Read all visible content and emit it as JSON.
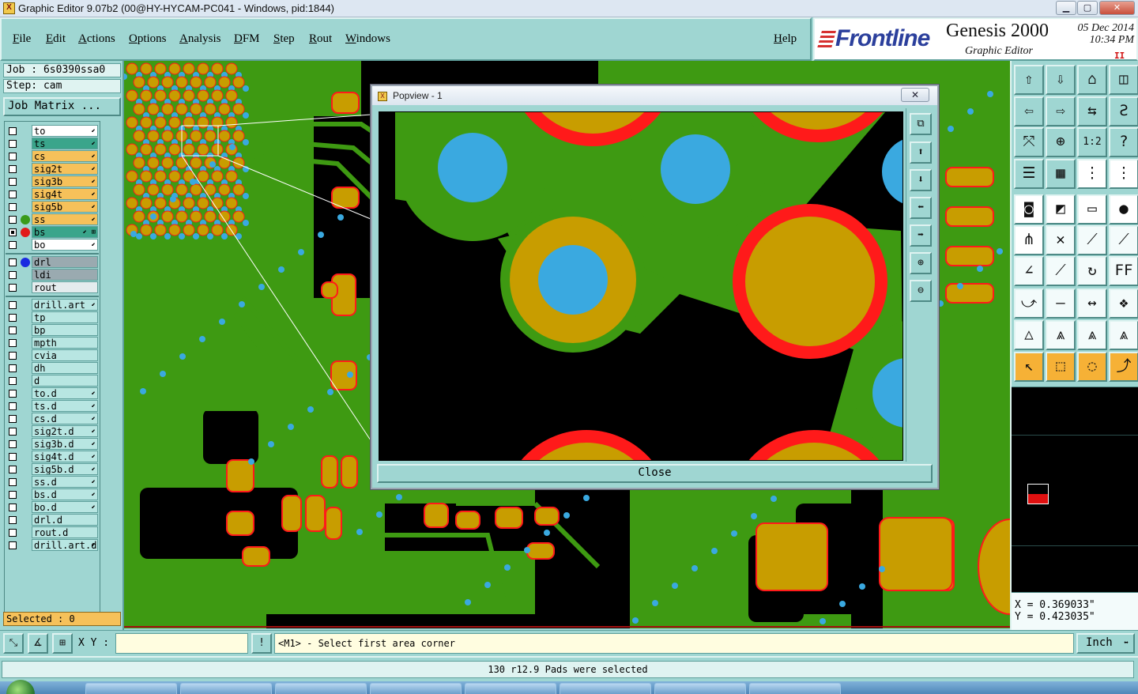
{
  "window": {
    "title": "Graphic Editor 9.07b2 (00@HY-HYCAM-PC041 - Windows, pid:1844)",
    "app_icon": "X"
  },
  "menu": {
    "items": [
      {
        "label": "File",
        "underline": "F",
        "rest": "ile"
      },
      {
        "label": "Edit",
        "underline": "E",
        "rest": "dit"
      },
      {
        "label": "Actions",
        "underline": "A",
        "rest": "ctions"
      },
      {
        "label": "Options",
        "underline": "O",
        "rest": "ptions"
      },
      {
        "label": "Analysis",
        "underline": "A",
        "rest": "nalysis"
      },
      {
        "label": "DFM",
        "underline": "D",
        "rest": "FM"
      },
      {
        "label": "Step",
        "underline": "S",
        "rest": "tep"
      },
      {
        "label": "Rout",
        "underline": "R",
        "rest": "out"
      },
      {
        "label": "Windows",
        "underline": "W",
        "rest": "indows"
      }
    ],
    "help": {
      "underline": "H",
      "rest": "elp"
    }
  },
  "brand": {
    "logo": "Frontline",
    "product": "Genesis 2000",
    "subtitle": "Graphic Editor",
    "date": "05 Dec 2014",
    "time": "10:34 PM",
    "pause_glyph": "II"
  },
  "job": {
    "job_line": "Job : 6s0390ssa0",
    "step_line": "Step: cam",
    "matrix_button": "Job Matrix ..."
  },
  "layers": [
    {
      "name": "to",
      "fill": "#ffffff",
      "dot": "",
      "mark": "⬋",
      "sel": false
    },
    {
      "name": "ts",
      "fill": "#3aa58b",
      "dot": "",
      "mark": "⬋",
      "sel": false
    },
    {
      "name": "cs",
      "fill": "#f6c15a",
      "dot": "",
      "mark": "⬋",
      "sel": false
    },
    {
      "name": "sig2t",
      "fill": "#f6c15a",
      "dot": "",
      "mark": "⬋",
      "sel": false
    },
    {
      "name": "sig3b",
      "fill": "#f6c15a",
      "dot": "",
      "mark": "⬋",
      "sel": false
    },
    {
      "name": "sig4t",
      "fill": "#f6c15a",
      "dot": "",
      "mark": "⬋",
      "sel": false
    },
    {
      "name": "sig5b",
      "fill": "#f6c15a",
      "dot": "",
      "mark": "⬋",
      "sel": false
    },
    {
      "name": "ss",
      "fill": "#f6c15a",
      "dot": "#3a9a1a",
      "mark": "⬋",
      "sel": false
    },
    {
      "name": "bs",
      "fill": "#3aa58b",
      "dot": "#e01a1a",
      "mark": "⬋ ⊞",
      "sel": true
    },
    {
      "name": "bo",
      "fill": "#ffffff",
      "dot": "",
      "mark": "⬋",
      "sel": false
    },
    {
      "name": "drl",
      "fill": "#9aaab0",
      "dot": "#1a2ae0",
      "mark": "",
      "sel": false
    },
    {
      "name": "ldi",
      "fill": "#9aaab0",
      "dot": "",
      "mark": "",
      "sel": false
    },
    {
      "name": "rout",
      "fill": "#e4ecee",
      "dot": "",
      "mark": "",
      "sel": false
    },
    {
      "name": "drill.art",
      "fill": "#b8e6e2",
      "dot": "",
      "mark": "⬋",
      "sel": false
    },
    {
      "name": "tp",
      "fill": "#b8e6e2",
      "dot": "",
      "mark": "",
      "sel": false
    },
    {
      "name": "bp",
      "fill": "#b8e6e2",
      "dot": "",
      "mark": "",
      "sel": false
    },
    {
      "name": "mpth",
      "fill": "#b8e6e2",
      "dot": "",
      "mark": "",
      "sel": false
    },
    {
      "name": "cvia",
      "fill": "#b8e6e2",
      "dot": "",
      "mark": "",
      "sel": false
    },
    {
      "name": "dh",
      "fill": "#b8e6e2",
      "dot": "",
      "mark": "",
      "sel": false
    },
    {
      "name": "d",
      "fill": "#b8e6e2",
      "dot": "",
      "mark": "",
      "sel": false
    },
    {
      "name": "to.d",
      "fill": "#b8e6e2",
      "dot": "",
      "mark": "⬋",
      "sel": false
    },
    {
      "name": "ts.d",
      "fill": "#b8e6e2",
      "dot": "",
      "mark": "⬋",
      "sel": false
    },
    {
      "name": "cs.d",
      "fill": "#b8e6e2",
      "dot": "",
      "mark": "⬋",
      "sel": false
    },
    {
      "name": "sig2t.d",
      "fill": "#b8e6e2",
      "dot": "",
      "mark": "⬋",
      "sel": false
    },
    {
      "name": "sig3b.d",
      "fill": "#b8e6e2",
      "dot": "",
      "mark": "⬋",
      "sel": false
    },
    {
      "name": "sig4t.d",
      "fill": "#b8e6e2",
      "dot": "",
      "mark": "⬋",
      "sel": false
    },
    {
      "name": "sig5b.d",
      "fill": "#b8e6e2",
      "dot": "",
      "mark": "⬋",
      "sel": false
    },
    {
      "name": "ss.d",
      "fill": "#b8e6e2",
      "dot": "",
      "mark": "⬋",
      "sel": false
    },
    {
      "name": "bs.d",
      "fill": "#b8e6e2",
      "dot": "",
      "mark": "⬋",
      "sel": false
    },
    {
      "name": "bo.d",
      "fill": "#b8e6e2",
      "dot": "",
      "mark": "⬋",
      "sel": false
    },
    {
      "name": "drl.d",
      "fill": "#b8e6e2",
      "dot": "",
      "mark": "",
      "sel": false
    },
    {
      "name": "rout.d",
      "fill": "#b8e6e2",
      "dot": "",
      "mark": "",
      "sel": false
    },
    {
      "name": "drill.art.d",
      "fill": "#b8e6e2",
      "dot": "",
      "mark": "⬋",
      "sel": false
    }
  ],
  "selected": "Selected : 0",
  "popview": {
    "title": "Popview - 1",
    "close_x": "✕",
    "close_button": "Close",
    "tools": [
      {
        "icon": "zoom-fit-icon",
        "glyph": "⧉"
      },
      {
        "icon": "pan-up-icon",
        "glyph": "⬆"
      },
      {
        "icon": "pan-down-icon",
        "glyph": "⬇"
      },
      {
        "icon": "pan-left-icon",
        "glyph": "⬅"
      },
      {
        "icon": "pan-right-icon",
        "glyph": "➡"
      },
      {
        "icon": "zoom-in-icon",
        "glyph": "⊕"
      },
      {
        "icon": "zoom-out-icon",
        "glyph": "⊖"
      }
    ]
  },
  "toolbox": [
    {
      "icon": "pan-up-icon",
      "glyph": "⇧",
      "style": ""
    },
    {
      "icon": "pan-down-icon",
      "glyph": "⇩",
      "style": ""
    },
    {
      "icon": "home-icon",
      "glyph": "⌂",
      "style": ""
    },
    {
      "icon": "window-split-icon",
      "glyph": "◫",
      "style": ""
    },
    {
      "icon": "pan-left-icon",
      "glyph": "⇦",
      "style": ""
    },
    {
      "icon": "pan-right-icon",
      "glyph": "⇨",
      "style": ""
    },
    {
      "icon": "swap-icon",
      "glyph": "⇆",
      "style": ""
    },
    {
      "icon": "redraw-icon",
      "glyph": "Ƨ",
      "style": ""
    },
    {
      "icon": "zoom-fit-icon",
      "glyph": "⤧",
      "style": ""
    },
    {
      "icon": "zoom-center-icon",
      "glyph": "⊕",
      "style": ""
    },
    {
      "icon": "scale-1-2-icon",
      "glyph": "1:2",
      "style": ""
    },
    {
      "icon": "help-icon",
      "glyph": "?",
      "style": ""
    },
    {
      "icon": "settings-icon",
      "glyph": "☰",
      "style": ""
    },
    {
      "icon": "grid-icon",
      "glyph": "▦",
      "style": ""
    },
    {
      "icon": "layers-icon",
      "glyph": "⋮",
      "style": "white"
    },
    {
      "icon": "layers-red-icon",
      "glyph": "⋮",
      "style": "white"
    },
    {
      "icon": "pad-select-icon",
      "glyph": "◙",
      "style": "white"
    },
    {
      "icon": "flip-icon",
      "glyph": "◩",
      "style": "white"
    },
    {
      "icon": "ruler-icon",
      "glyph": "▭",
      "style": "white"
    },
    {
      "icon": "dot-icon",
      "glyph": "●",
      "style": "white"
    },
    {
      "icon": "connect-icon",
      "glyph": "⋔",
      "style": "white"
    },
    {
      "icon": "cross-icon",
      "glyph": "✕",
      "style": "wht2"
    },
    {
      "icon": "line-icon",
      "glyph": "⟋",
      "style": "wht2"
    },
    {
      "icon": "line-red-icon",
      "glyph": "⟋",
      "style": "wht2"
    },
    {
      "icon": "angle-icon",
      "glyph": "∠",
      "style": "wht2"
    },
    {
      "icon": "diagonal-icon",
      "glyph": "⟋",
      "style": "wht2"
    },
    {
      "icon": "rotate-icon",
      "glyph": "↻",
      "style": "wht2"
    },
    {
      "icon": "ff-icon",
      "glyph": "FF",
      "style": "wht2"
    },
    {
      "icon": "arc-icon",
      "glyph": "⤻",
      "style": "wht2"
    },
    {
      "icon": "minus-icon",
      "glyph": "—",
      "style": "wht2"
    },
    {
      "icon": "measure-icon",
      "glyph": "↔",
      "style": "wht2"
    },
    {
      "icon": "group-icon",
      "glyph": "❖",
      "style": "wht2"
    },
    {
      "icon": "triangle-icon",
      "glyph": "△",
      "style": "wht2"
    },
    {
      "icon": "triangle-up-icon",
      "glyph": "⩓",
      "style": "wht2"
    },
    {
      "icon": "triangle-red-icon",
      "glyph": "⩓",
      "style": "wht2"
    },
    {
      "icon": "triangle-blue-icon",
      "glyph": "⩓",
      "style": "wht2"
    },
    {
      "icon": "pointer-icon",
      "glyph": "↖",
      "style": "orange"
    },
    {
      "icon": "pointer-box-icon",
      "glyph": "⬚",
      "style": "orange"
    },
    {
      "icon": "pointer-circle-icon",
      "glyph": "◌",
      "style": "orange"
    },
    {
      "icon": "pointer-path-icon",
      "glyph": "⤴",
      "style": "orange"
    }
  ],
  "coords": {
    "x": "X = 0.369033\"",
    "y": "Y = 0.423035\""
  },
  "command": {
    "xy_label": "X Y :",
    "xy_value": "",
    "info_glyph": "!",
    "prompt": "<M1> - Select first area corner",
    "unit": "Inch",
    "unit_arrow": "⬌"
  },
  "status": "130 r12.9 Pads were selected",
  "colors": {
    "green": "#3e9a12",
    "gold": "#c89d00",
    "red": "#ff1a1a",
    "blue": "#3aa9e0",
    "teal": "#9fd6d2"
  }
}
